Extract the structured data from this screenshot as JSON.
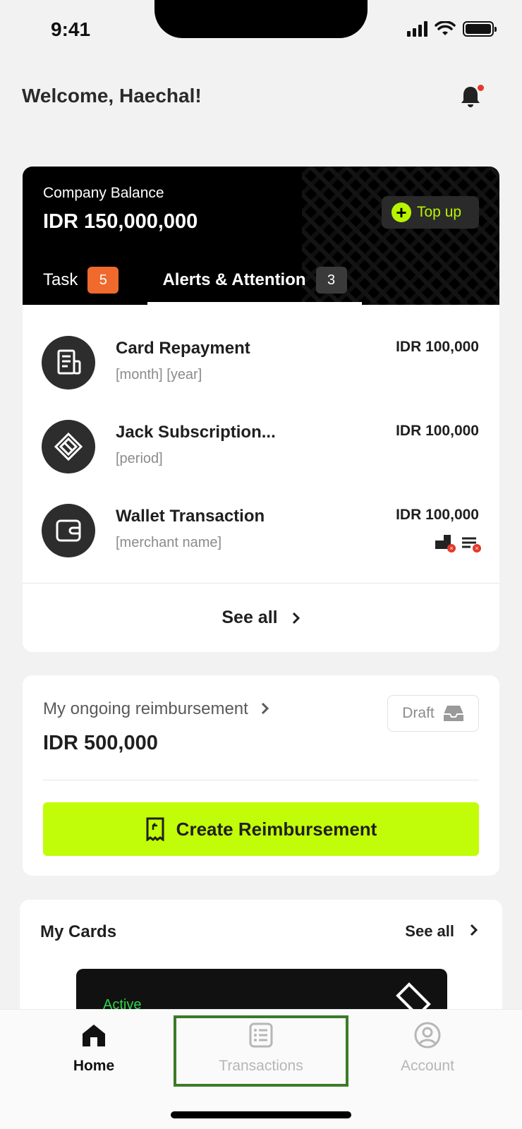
{
  "status_bar": {
    "time": "9:41"
  },
  "header": {
    "welcome": "Welcome, Haechal!"
  },
  "balance": {
    "label": "Company Balance",
    "amount": "IDR 150,000,000",
    "topup_label": "Top up"
  },
  "tabs": {
    "task": {
      "label": "Task",
      "count": "5"
    },
    "alerts": {
      "label": "Alerts & Attention",
      "count": "3"
    }
  },
  "alerts": [
    {
      "title": "Card Repayment",
      "subtitle": "[month] [year]",
      "amount": "IDR 100,000",
      "icon": "receipt-icon"
    },
    {
      "title": "Jack Subscription...",
      "subtitle": "[period]",
      "amount": "IDR 100,000",
      "icon": "jack-logo-icon"
    },
    {
      "title": "Wallet Transaction",
      "subtitle": "[merchant name]",
      "amount": "IDR 100,000",
      "icon": "wallet-icon"
    }
  ],
  "alerts_see_all": "See all",
  "reimbursement": {
    "label": "My ongoing reimbursement",
    "amount": "IDR 500,000",
    "draft_label": "Draft",
    "create_label": "Create Reimbursement"
  },
  "my_cards": {
    "title": "My Cards",
    "see_all": "See all",
    "card_status": "Active"
  },
  "nav": {
    "home": "Home",
    "transactions": "Transactions",
    "account": "Account"
  },
  "colors": {
    "accent_lime": "#c1fd08",
    "topup_green": "#b7f400",
    "task_badge": "#ef6a2c",
    "notification_dot": "#e23a2c",
    "highlight_border": "#3d7a29"
  }
}
